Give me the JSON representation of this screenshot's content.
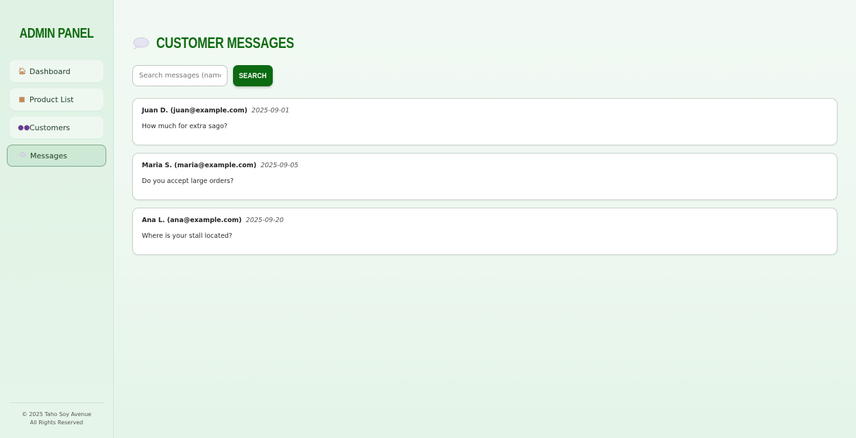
{
  "sidebar": {
    "brand": "ADMIN PANEL",
    "items": [
      {
        "label": "Dashboard",
        "icon": "house-icon",
        "active": false
      },
      {
        "label": "Product List",
        "icon": "box-icon",
        "active": false
      },
      {
        "label": "Customers",
        "icon": "people-icon",
        "active": false
      },
      {
        "label": "Messages",
        "icon": "speech-bubble-icon",
        "active": true
      }
    ],
    "footer": {
      "line1": "© 2025 Taho Soy Avenue",
      "line2": "All Rights Reserved"
    }
  },
  "main": {
    "title": "CUSTOMER MESSAGES",
    "title_icon": "speech-bubble-icon",
    "search": {
      "placeholder": "Search messages (name, email...)",
      "value": "",
      "button_label": "SEARCH"
    },
    "messages": [
      {
        "sender": "Juan D. (juan@example.com)",
        "date": "2025-09-01",
        "body": "How much for extra sago?"
      },
      {
        "sender": "Maria S. (maria@example.com)",
        "date": "2025-09-05",
        "body": "Do you accept large orders?"
      },
      {
        "sender": "Ana L. (ana@example.com)",
        "date": "2025-09-20",
        "body": "Where is your stall located?"
      }
    ]
  },
  "colors": {
    "brand_green": "#0f6b10",
    "button_green": "#0b6a12",
    "sidebar_bg": "#dff2e4",
    "active_item_bg": "#cde9d5"
  }
}
